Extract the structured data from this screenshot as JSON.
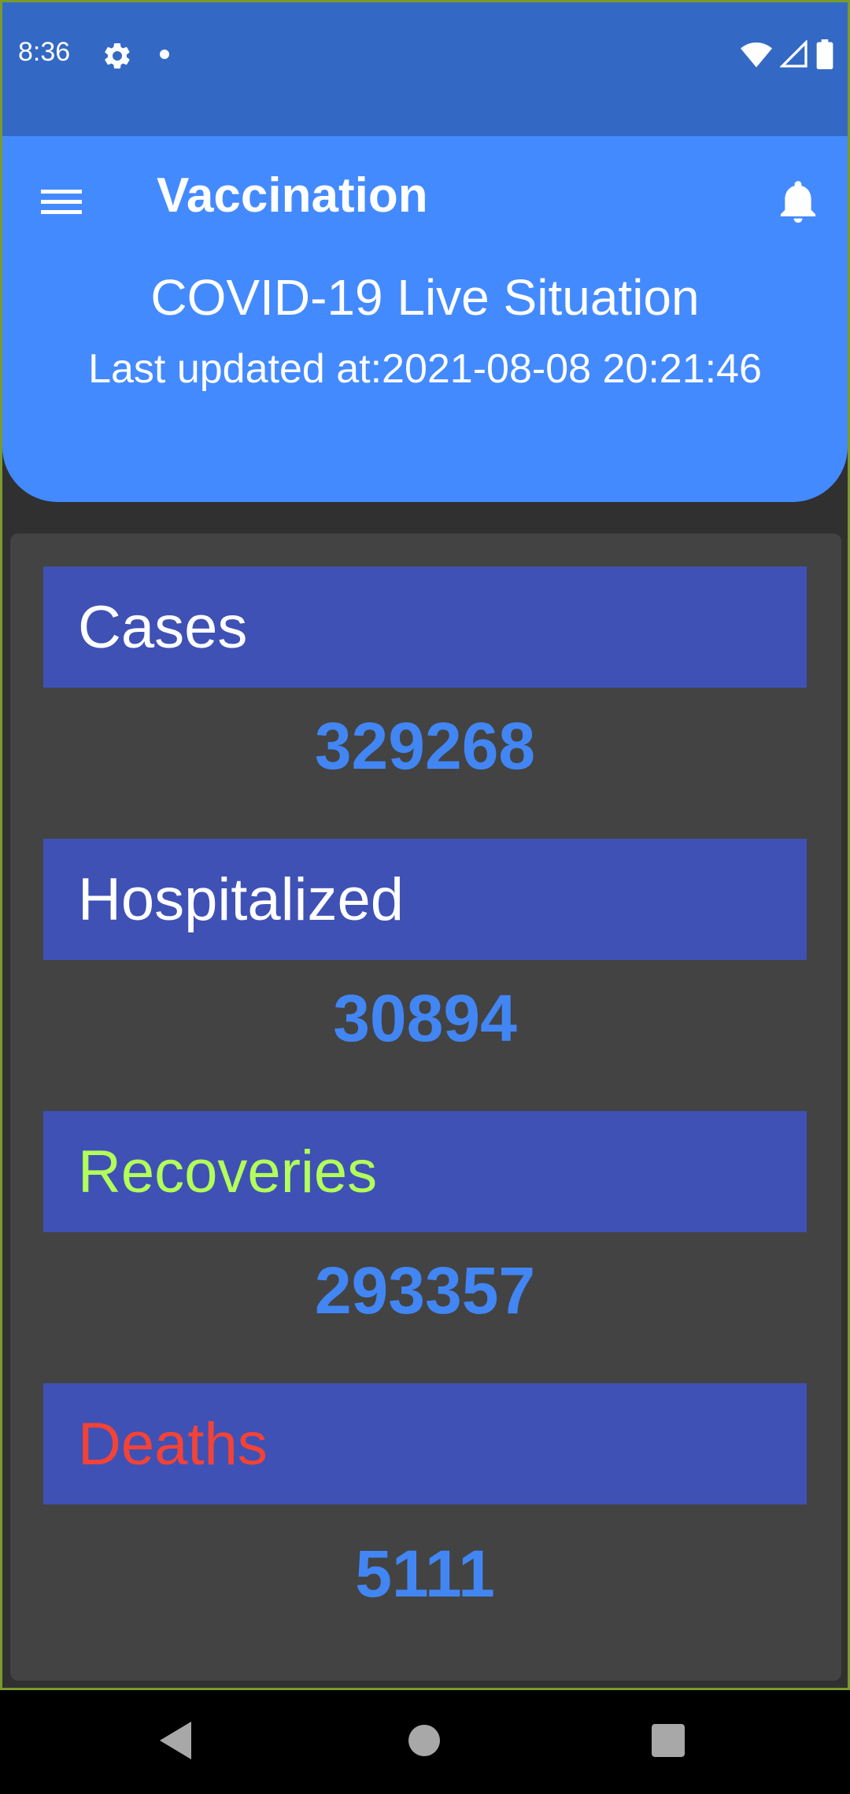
{
  "status_bar": {
    "time": "8:36",
    "icons": [
      "gear-icon",
      "notification-dot-icon",
      "wifi-icon",
      "cellular-signal-icon",
      "battery-icon"
    ]
  },
  "toolbar": {
    "title": "Vaccination",
    "menu_icon": "hamburger-menu-icon",
    "notification_icon": "bell-icon"
  },
  "header": {
    "subtitle": "COVID-19 Live Situation",
    "last_updated": "Last updated at:2021-08-08 20:21:46"
  },
  "stats": [
    {
      "label": "Cases",
      "value": "329268",
      "label_color": "#ffffff"
    },
    {
      "label": "Hospitalized",
      "value": "30894",
      "label_color": "#ffffff"
    },
    {
      "label": "Recoveries",
      "value": "293357",
      "label_color": "#b2ff59"
    },
    {
      "label": "Deaths",
      "value": "5111",
      "label_color": "#f44336"
    }
  ],
  "colors": {
    "status_bar": "#3369c4",
    "header": "#448aff",
    "label_bar": "#3f51b5",
    "value_text": "#4286f4",
    "card_background": "#434343"
  },
  "nav_bar": {
    "icons": [
      "back-icon",
      "home-icon",
      "recents-icon"
    ]
  }
}
